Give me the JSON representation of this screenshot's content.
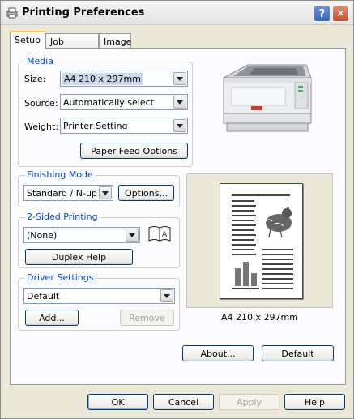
{
  "window": {
    "title": "Printing Preferences",
    "help_label": "?",
    "close_label": "✕"
  },
  "tabs": [
    {
      "label": "Setup"
    },
    {
      "label": "Job Options"
    },
    {
      "label": "Image"
    }
  ],
  "media": {
    "group_label": "Media",
    "size_label": "Size:",
    "size_value": "A4 210 x 297mm",
    "source_label": "Source:",
    "source_value": "Automatically select",
    "weight_label": "Weight:",
    "weight_value": "Printer Setting",
    "paper_feed_button": "Paper Feed Options"
  },
  "finishing": {
    "group_label": "Finishing Mode",
    "value": "Standard / N-up",
    "options_button": "Options..."
  },
  "two_sided": {
    "group_label": "2-Sided Printing",
    "value": "(None)",
    "duplex_help_button": "Duplex Help"
  },
  "driver": {
    "group_label": "Driver Settings",
    "value": "Default",
    "add_button": "Add...",
    "remove_button": "Remove"
  },
  "preview": {
    "caption": "A4 210 x 297mm"
  },
  "panel_buttons": {
    "about": "About...",
    "default": "Default"
  },
  "dialog_buttons": {
    "ok": "OK",
    "cancel": "Cancel",
    "apply": "Apply",
    "help": "Help"
  }
}
